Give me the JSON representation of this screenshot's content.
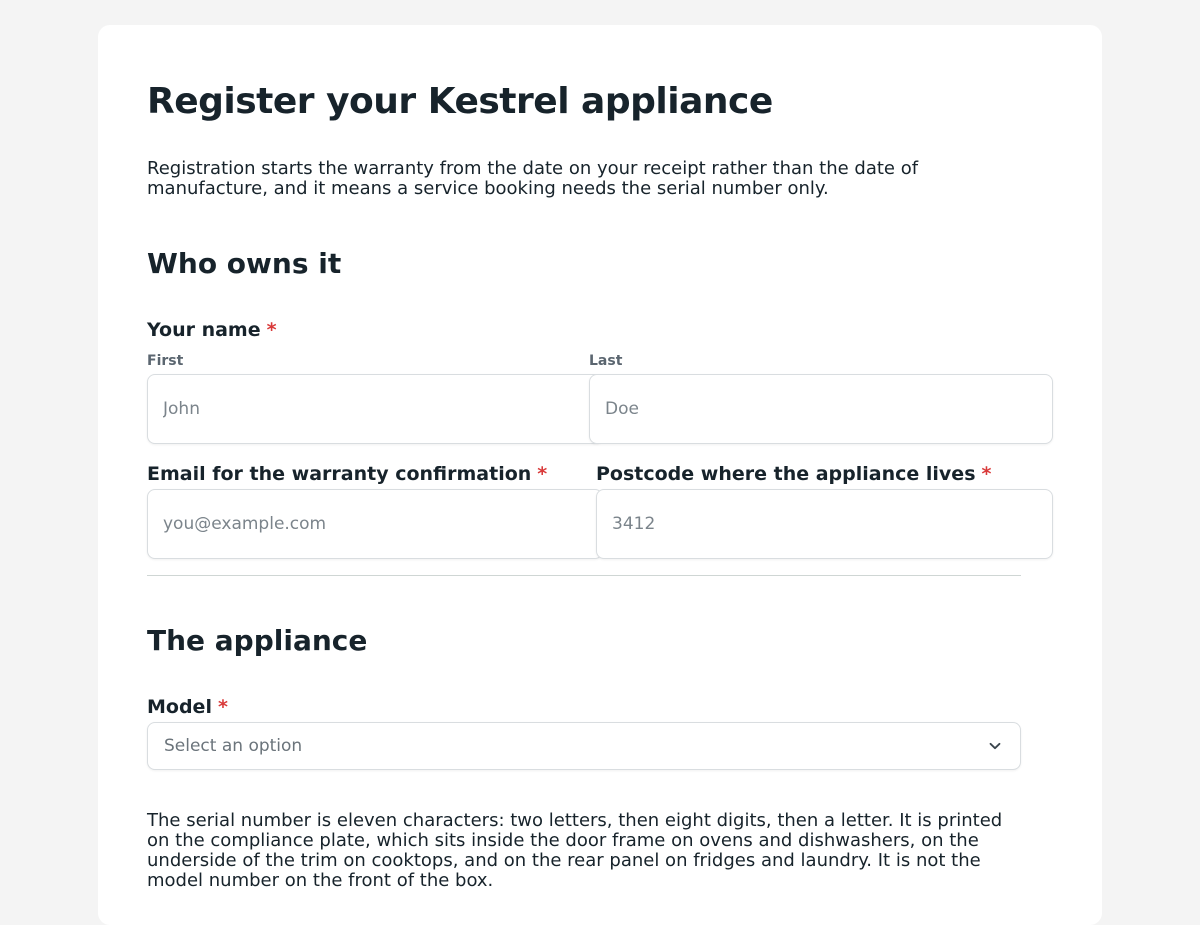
{
  "form": {
    "title": "Register your Kestrel appliance",
    "intro": "Registration starts the warranty from the date on your receipt rather than the date of manufacture, and it means a service booking needs the serial number only."
  },
  "owner_section": {
    "heading": "Who owns it",
    "name_label": "Your name",
    "required_marker": "*",
    "first_label": "First",
    "first_placeholder": "John",
    "last_label": "Last",
    "last_placeholder": "Doe",
    "email_label": "Email for the warranty confirmation",
    "email_placeholder": "you@example.com",
    "postcode_label": "Postcode where the appliance lives",
    "postcode_placeholder": "3412"
  },
  "appliance_section": {
    "heading": "The appliance",
    "model_label": "Model",
    "model_placeholder": "Select an option",
    "chevron_icon": "chevron-down-icon",
    "serial_help": "The serial number is eleven characters: two letters, then eight digits, then a letter. It is printed on the compliance plate, which sits inside the door frame on ovens and dishwashers, on the underside of the trim on cooktops, and on the rear panel on fridges and laundry. It is not the model number on the front of the box."
  },
  "colors": {
    "background": "#f4f4f4",
    "card": "#ffffff",
    "text": "#17232b",
    "required": "#d93a3a",
    "border": "#d9dde0"
  }
}
